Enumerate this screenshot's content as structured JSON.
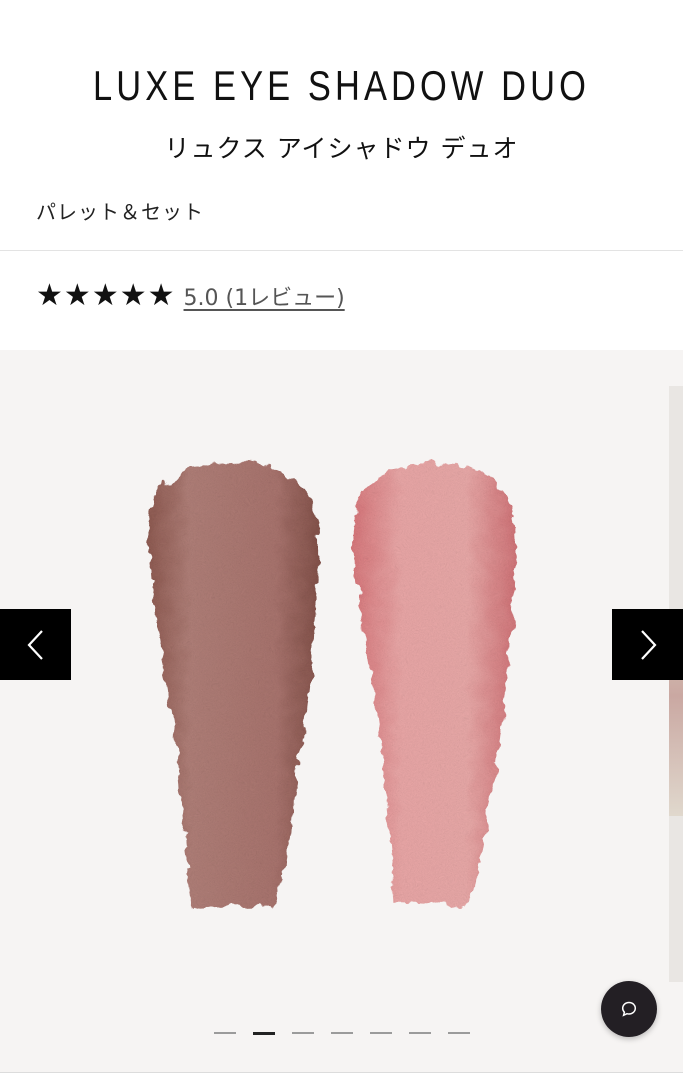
{
  "product": {
    "title": "LUXE EYE SHADOW DUO",
    "subtitle": "リュクス アイシャドウ デュオ",
    "category": "パレット＆セット"
  },
  "rating": {
    "stars": 5,
    "star_glyph": "★",
    "review_text": "5.0 (1レビュー)"
  },
  "gallery": {
    "slide_count": 7,
    "active_slide": 2,
    "swatch_colors": [
      "#a9746e",
      "#e59a9c"
    ],
    "prev_icon": "chevron-left-icon",
    "next_icon": "chevron-right-icon"
  },
  "chat": {
    "icon": "chat-bubble-icon"
  }
}
